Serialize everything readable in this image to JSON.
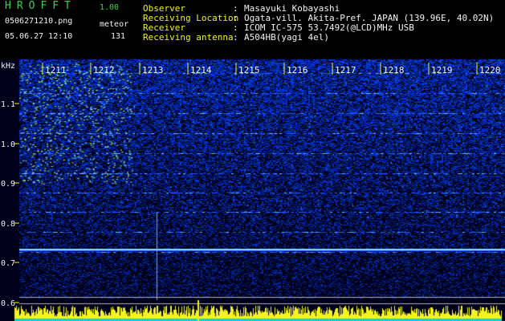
{
  "header": {
    "app_title": "HROFFT",
    "version": "1.00",
    "file_name": "0506271210.png",
    "mode": "meteor",
    "timestamp": "05.06.27 12:10",
    "count": "131",
    "info": [
      {
        "label": "Observer",
        "value": "Masayuki Kobayashi"
      },
      {
        "label": "Receiving Location",
        "value": "Ogata-vill. Akita-Pref. JAPAN (139.96E, 40.02N)"
      },
      {
        "label": "Receiver",
        "value": "ICOM IC-575 53.7492(@LCD)MHz USB"
      },
      {
        "label": "Receiving antenna",
        "value": "A504HB(yagi 4el)"
      }
    ]
  },
  "axis": {
    "unit": "kHz",
    "freq_ticks": [
      "1.1",
      "1.0",
      "0.9",
      "0.8",
      "0.7",
      "0.6"
    ],
    "time_ticks": [
      "1211",
      "1212",
      "1213",
      "1214",
      "1215",
      "1216",
      "1217",
      "1218",
      "1219",
      "1220"
    ]
  },
  "colors": {
    "header_text": "#f2f2f2",
    "title_green": "#37d24a",
    "axis_yellow": "#f3f31e",
    "background_dark": "#000018",
    "carrier_cyan": "#7fe0ff",
    "noise_blue": "#1a3cff"
  }
}
